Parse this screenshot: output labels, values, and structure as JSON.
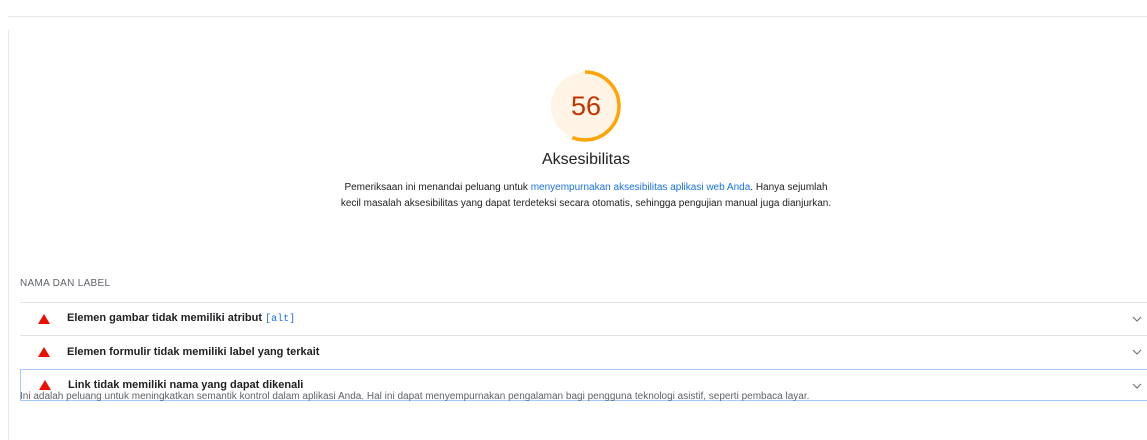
{
  "category": {
    "score": "56",
    "score_fraction": 0.56,
    "title": "Aksesibilitas",
    "description_prefix": "Pemeriksaan ini menandai peluang untuk ",
    "description_link": "menyempurnakan aksesibilitas aplikasi web Anda",
    "description_suffix": ". Hanya sejumlah kecil masalah aksesibilitas yang dapat terdeteksi secara otomatis, sehingga pengujian manual juga dianjurkan.",
    "colors": {
      "score": "#c33300",
      "gauge_arc": "#ffa400",
      "gauge_fill": "#fff4e5",
      "fail": "#eb0f00",
      "link": "#1a73e8"
    }
  },
  "group": {
    "title": "NAMA DAN LABEL",
    "audits": [
      {
        "title": "Elemen gambar tidak memiliki atribut ",
        "code": "[alt]",
        "status_icon": "fail-triangle-icon",
        "expanded": false
      },
      {
        "title": "Elemen formulir tidak memiliki label yang terkait",
        "code": "",
        "status_icon": "fail-triangle-icon",
        "expanded": false
      },
      {
        "title": "Link tidak memiliki nama yang dapat dikenali",
        "code": "",
        "status_icon": "fail-triangle-icon",
        "expanded": true
      }
    ],
    "expanded_description": "Ini adalah peluang untuk meningkatkan semantik kontrol dalam aplikasi Anda. Hal ini dapat menyempurnakan pengalaman bagi pengguna teknologi asistif, seperti pembaca layar."
  }
}
